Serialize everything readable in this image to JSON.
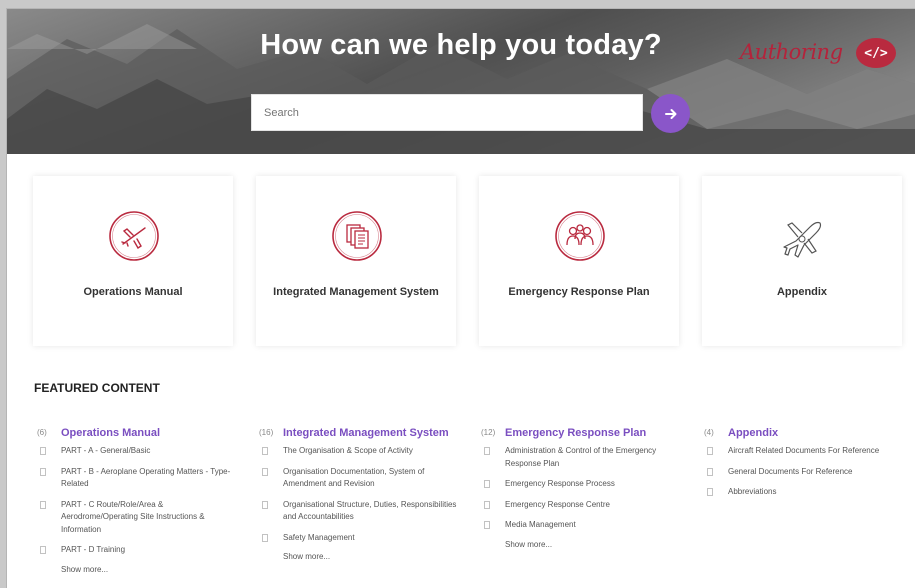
{
  "hero": {
    "title": "How can we help you today?",
    "search": {
      "placeholder": "Search"
    },
    "search_button_icon": "arrow-right-icon",
    "logo": {
      "text": "Authoring",
      "badge": "</>"
    }
  },
  "categories": [
    {
      "label": "Operations Manual",
      "icon": "airplane-icon"
    },
    {
      "label": "Integrated Management System",
      "icon": "documents-icon"
    },
    {
      "label": "Emergency Response Plan",
      "icon": "people-icon"
    },
    {
      "label": "Appendix",
      "icon": "crashed-airplane-icon"
    }
  ],
  "featured": {
    "heading": "FEATURED CONTENT",
    "columns": [
      {
        "count": "(6)",
        "title": "Operations Manual",
        "items": [
          "PART - A - General/Basic",
          "PART - B - Aeroplane Operating Matters - Type-Related",
          "PART - C Route/Role/Area & Aerodrome/Operating Site Instructions & Information",
          "PART - D Training"
        ],
        "show_more": "Show more..."
      },
      {
        "count": "(16)",
        "title": "Integrated Management System",
        "items": [
          "The Organisation & Scope of Activity",
          "Organisation Documentation, System of Amendment and Revision",
          "Organisational Structure, Duties, Responsibilities and Accountabilities",
          "Safety Management"
        ],
        "show_more": "Show more..."
      },
      {
        "count": "(12)",
        "title": "Emergency Response Plan",
        "items": [
          "Administration & Control of the Emergency Response Plan",
          "Emergency Response Process",
          "Emergency Response Centre",
          "Media Management"
        ],
        "show_more": "Show more..."
      },
      {
        "count": "(4)",
        "title": "Appendix",
        "items": [
          "Aircraft Related Documents For Reference",
          "General Documents For Reference",
          "Abbreviations"
        ],
        "show_more": ""
      }
    ]
  },
  "colors": {
    "accent": "#8a56c9",
    "brand_red": "#b92a3f",
    "link_purple": "#7a4ec0"
  }
}
